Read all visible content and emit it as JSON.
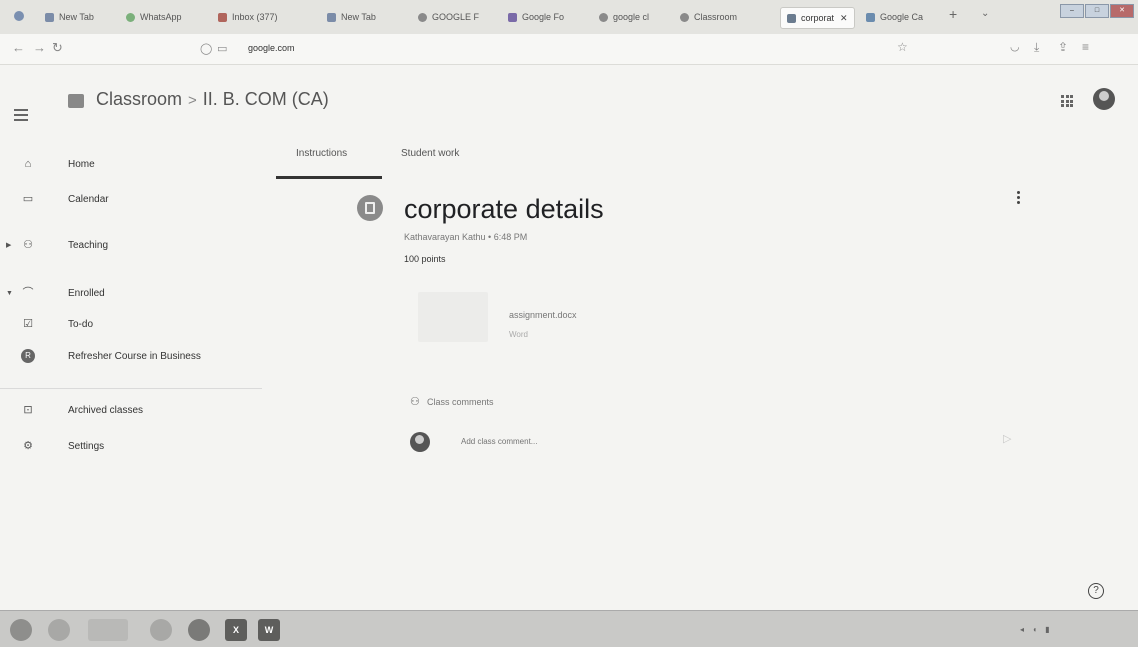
{
  "browser": {
    "tabs": [
      {
        "label": "New Tab"
      },
      {
        "label": "WhatsApp"
      },
      {
        "label": "Inbox (377)"
      },
      {
        "label": "New Tab"
      },
      {
        "label": "GOOGLE F"
      },
      {
        "label": "Google Fo"
      },
      {
        "label": "google cl"
      },
      {
        "label": "Classroom"
      },
      {
        "label": "corporat",
        "active": true
      },
      {
        "label": "Google Ca"
      }
    ],
    "url_domain": "google.com"
  },
  "header": {
    "app_name": "Classroom",
    "breadcrumb_separator": ">",
    "course": "II. B. COM (CA)"
  },
  "sidebar": {
    "items": [
      {
        "label": "Home",
        "icon": "home-icon"
      },
      {
        "label": "Calendar",
        "icon": "calendar-icon"
      },
      {
        "label": "Teaching",
        "icon": "people-icon"
      },
      {
        "label": "Enrolled",
        "icon": "graduation-cap-icon"
      },
      {
        "label": "To-do",
        "icon": "todo-icon"
      },
      {
        "label": "Refresher Course in Business",
        "icon": "course-avatar",
        "initial": "R"
      },
      {
        "label": "Archived classes",
        "icon": "archive-icon"
      },
      {
        "label": "Settings",
        "icon": "settings-icon"
      }
    ]
  },
  "main": {
    "tabs": [
      {
        "label": "Instructions"
      },
      {
        "label": "Student work"
      }
    ],
    "assignment": {
      "title": "corporate details",
      "meta": "Kathavarayan Kathu • 6:48 PM",
      "points": "100 points"
    },
    "attachment": {
      "name": "assignment.docx",
      "type": "Word"
    },
    "comments": {
      "label": "Class comments",
      "placeholder": "Add class comment..."
    }
  },
  "colors": {
    "accent": "#333333",
    "page_bg": "#f4f4f2"
  }
}
